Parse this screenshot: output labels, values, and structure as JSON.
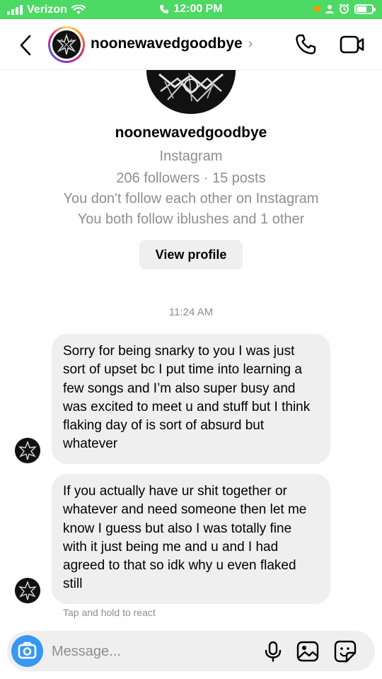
{
  "status_bar": {
    "carrier": "Verizon",
    "time": "12:00 PM"
  },
  "header": {
    "username": "noonewavedgoodbye",
    "chevron": "›"
  },
  "profile": {
    "username": "noonewavedgoodbye",
    "platform": "Instagram",
    "stats": "206 followers · 15 posts",
    "follow_status": "You don't follow each other on Instagram",
    "mutuals": "You both follow iblushes and 1 other",
    "view_profile_label": "View profile"
  },
  "conversation": {
    "timestamp": "11:24 AM",
    "messages": [
      {
        "text": "Sorry for being snarky to you I was just sort of upset bc I put time into learning a few songs and I’m also super busy and was excited to meet u and stuff but I think flaking day of is sort of absurd but whatever"
      },
      {
        "text": "If you actually have ur shit together or whatever and need someone then let me know I guess but also I was totally fine with it just being me and u and I had agreed to that so idk why u even flaked still"
      }
    ],
    "react_hint": "Tap and hold to react"
  },
  "composer": {
    "placeholder": "Message..."
  },
  "colors": {
    "status_bar": "#4cd964",
    "bubble": "#efefef",
    "camera_button": "#3897f0",
    "secondary_text": "#8e8e8e"
  },
  "icons": [
    "signal-icon",
    "wifi-icon",
    "phone-small-icon",
    "orange-dot-icon",
    "location-icon",
    "alarm-icon",
    "battery-icon",
    "back-arrow-icon",
    "phone-icon",
    "video-camera-icon",
    "camera-icon",
    "microphone-icon",
    "gallery-icon",
    "sticker-icon"
  ]
}
